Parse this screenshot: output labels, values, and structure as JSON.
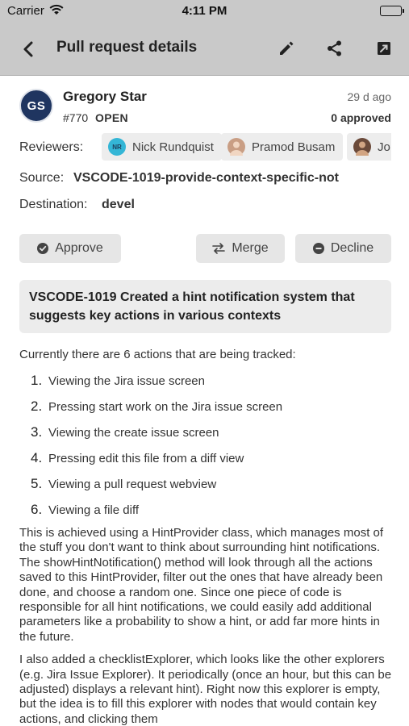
{
  "status_bar": {
    "carrier": "Carrier",
    "time": "4:11 PM"
  },
  "nav": {
    "title": "Pull request details"
  },
  "pr": {
    "author_initials": "GS",
    "author": "Gregory Star",
    "number": "#770",
    "state": "OPEN",
    "age": "29 d ago",
    "approvals": "0 approved"
  },
  "reviewers": {
    "label": "Reviewers:",
    "items": [
      {
        "name": "Nick Rundquist",
        "initials": "NR",
        "avatar_color": "#34b6d6"
      },
      {
        "name": "Pramod Busam",
        "initials": "",
        "avatar_color": "#c99e84"
      },
      {
        "name": "Jo",
        "initials": "",
        "avatar_color": "#6b4a3a"
      }
    ]
  },
  "source": {
    "label": "Source:",
    "value": "VSCODE-1019-provide-context-specific-not"
  },
  "destination": {
    "label": "Destination:",
    "value": "devel"
  },
  "actions": {
    "approve": "Approve",
    "merge": "Merge",
    "decline": "Decline"
  },
  "title": "VSCODE-1019 Created a hint notification system that suggests key actions in various contexts",
  "description": {
    "intro": "Currently there are 6 actions that are being tracked:",
    "items": [
      {
        "num": "1.",
        "text": "Viewing the Jira issue screen"
      },
      {
        "num": "2.",
        "text": "Pressing start work on the Jira issue screen"
      },
      {
        "num": "3.",
        "text": "Viewing the create issue screen"
      },
      {
        "num": "4.",
        "text": "Pressing edit this file from a diff view"
      },
      {
        "num": "5.",
        "text": "Viewing a pull request webview"
      },
      {
        "num": "6.",
        "text": "Viewing a file diff"
      }
    ],
    "paragraph1": "This is achieved using a HintProvider class, which manages most of the stuff you don't want to think about surrounding hint notifications. The showHintNotification() method will look through all the actions saved to this HintProvider, filter out the ones that have already been done, and choose a random one. Since one piece of code is responsible for all hint notifications, we could easily add additional parameters like a probability to show a hint, or add far more hints in the future.",
    "paragraph2": "I also added a checklistExplorer, which looks like the other explorers (e.g. Jira Issue Explorer). It periodically (once an hour, but this can be adjusted) displays a relevant hint). Right now this explorer is empty, but the idea is to fill this explorer with nodes that would contain key actions, and clicking them"
  }
}
